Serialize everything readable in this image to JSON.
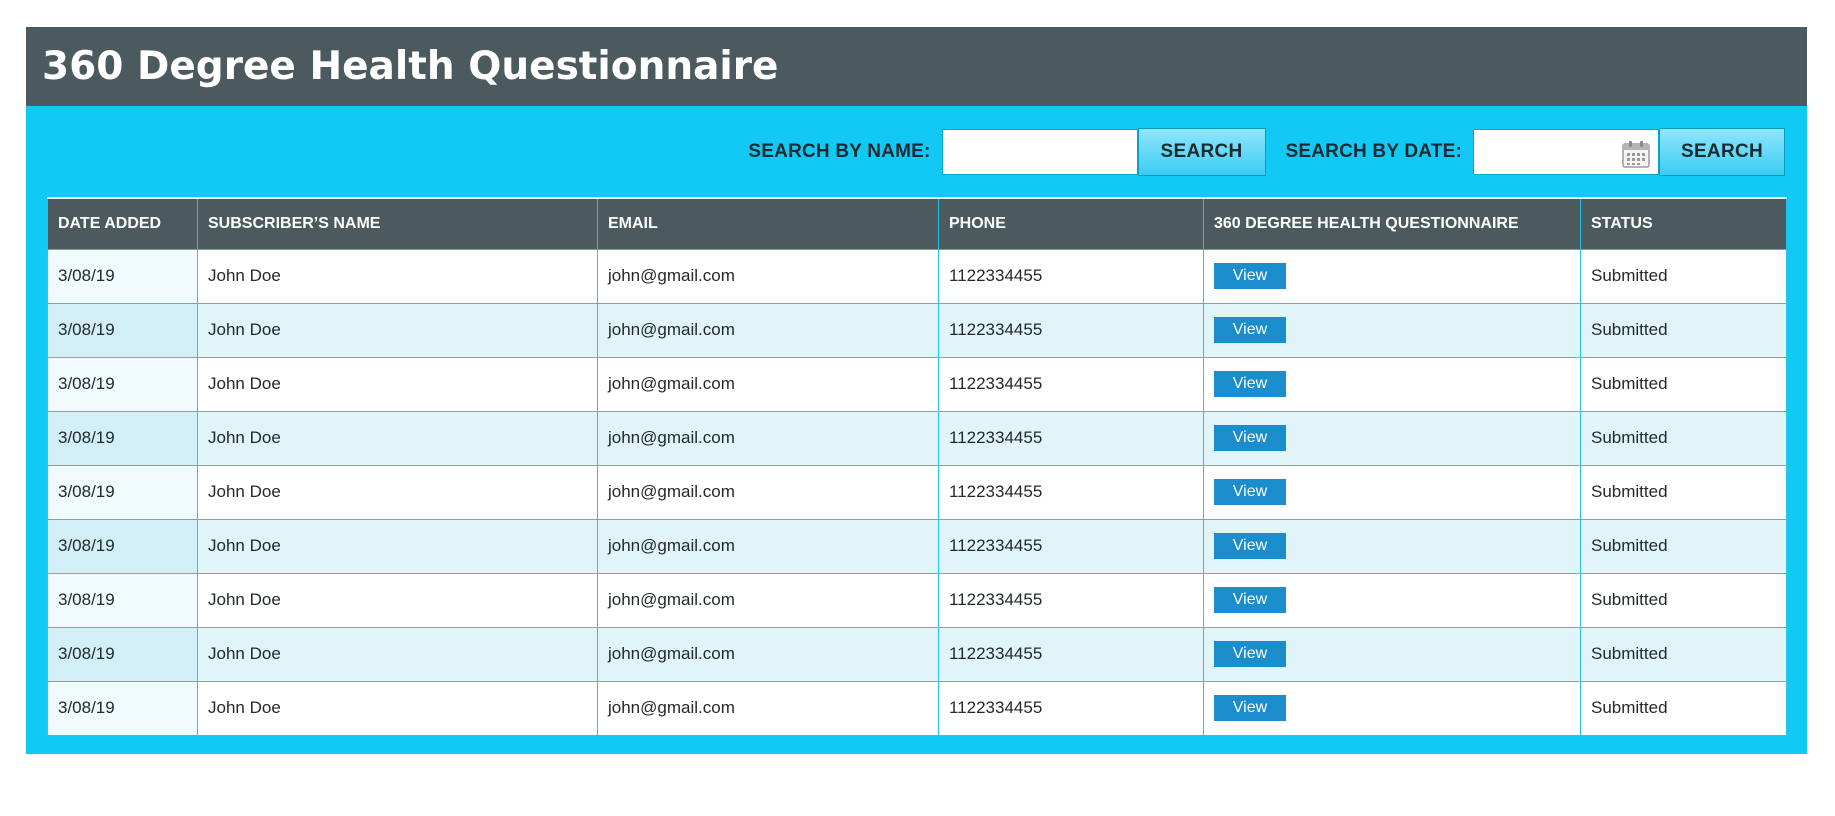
{
  "header": {
    "title": "360 Degree Health Questionnaire"
  },
  "search": {
    "name_label": "SEARCH BY NAME:",
    "name_value": "",
    "name_button": "SEARCH",
    "date_label": "SEARCH BY DATE:",
    "date_value": "",
    "date_button": "SEARCH",
    "date_icon": "calendar-icon"
  },
  "table": {
    "columns": [
      "DATE ADDED",
      "SUBSCRIBER’S NAME",
      "EMAIL",
      "PHONE",
      "360 DEGREE HEALTH QUESTIONNAIRE",
      "STATUS"
    ],
    "rows": [
      {
        "date": "3/08/19",
        "name": "John Doe",
        "email": "john@gmail.com",
        "phone": "1122334455",
        "action": "View",
        "status": "Submitted"
      },
      {
        "date": "3/08/19",
        "name": "John Doe",
        "email": "john@gmail.com",
        "phone": "1122334455",
        "action": "View",
        "status": "Submitted"
      },
      {
        "date": "3/08/19",
        "name": "John Doe",
        "email": "john@gmail.com",
        "phone": "1122334455",
        "action": "View",
        "status": "Submitted"
      },
      {
        "date": "3/08/19",
        "name": "John Doe",
        "email": "john@gmail.com",
        "phone": "1122334455",
        "action": "View",
        "status": "Submitted"
      },
      {
        "date": "3/08/19",
        "name": "John Doe",
        "email": "john@gmail.com",
        "phone": "1122334455",
        "action": "View",
        "status": "Submitted"
      },
      {
        "date": "3/08/19",
        "name": "John Doe",
        "email": "john@gmail.com",
        "phone": "1122334455",
        "action": "View",
        "status": "Submitted"
      },
      {
        "date": "3/08/19",
        "name": "John Doe",
        "email": "john@gmail.com",
        "phone": "1122334455",
        "action": "View",
        "status": "Submitted"
      },
      {
        "date": "3/08/19",
        "name": "John Doe",
        "email": "john@gmail.com",
        "phone": "1122334455",
        "action": "View",
        "status": "Submitted"
      },
      {
        "date": "3/08/19",
        "name": "John Doe",
        "email": "john@gmail.com",
        "phone": "1122334455",
        "action": "View",
        "status": "Submitted"
      }
    ]
  },
  "colors": {
    "panel": "#12c8f5",
    "header": "#4b5a5e",
    "view_button": "#1a8ecc",
    "alt_row": "#e0f4f9"
  }
}
